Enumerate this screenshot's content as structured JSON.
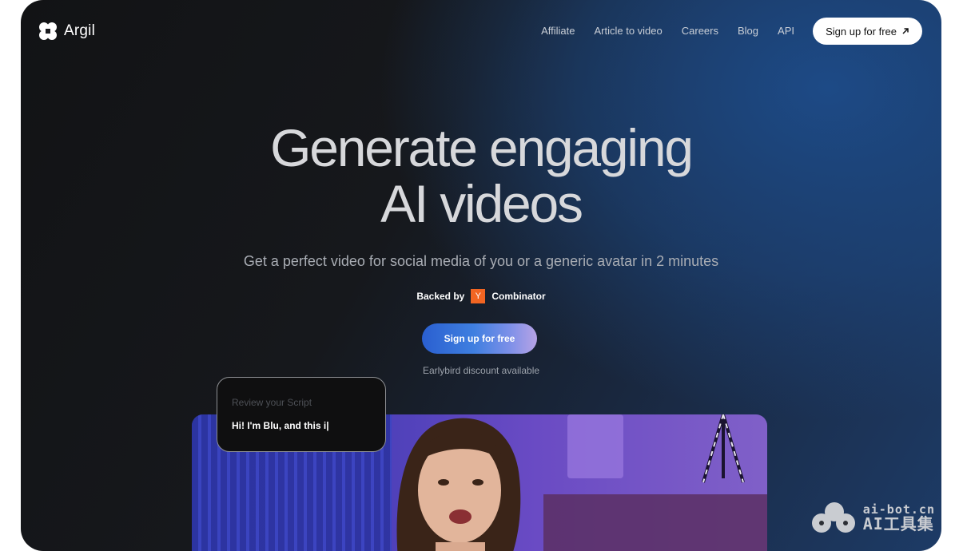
{
  "brand": {
    "name": "Argil",
    "icon": "clover-logo-icon"
  },
  "nav": {
    "links": [
      "Affiliate",
      "Article to video",
      "Careers",
      "Blog",
      "API"
    ],
    "cta_label": "Sign up for free",
    "cta_icon": "arrow-up-right-icon"
  },
  "hero": {
    "title_line1": "Generate engaging",
    "title_line2": "AI videos",
    "subtitle": "Get a perfect video for social media of you or a generic avatar in 2 minutes",
    "backed_label": "Backed by",
    "yc_letter": "Y",
    "yc_name": "Combinator",
    "cta_label": "Sign up for free",
    "note": "Earlybird discount available"
  },
  "script_card": {
    "label": "Review your Script",
    "text": "Hi! I'm Blu, and this i|"
  },
  "watermark": {
    "line1": "ai-bot.cn",
    "line2": "AI工具集"
  },
  "colors": {
    "accent": "#3f7fe0",
    "yc_orange": "#f26522",
    "background": "#16181c"
  }
}
